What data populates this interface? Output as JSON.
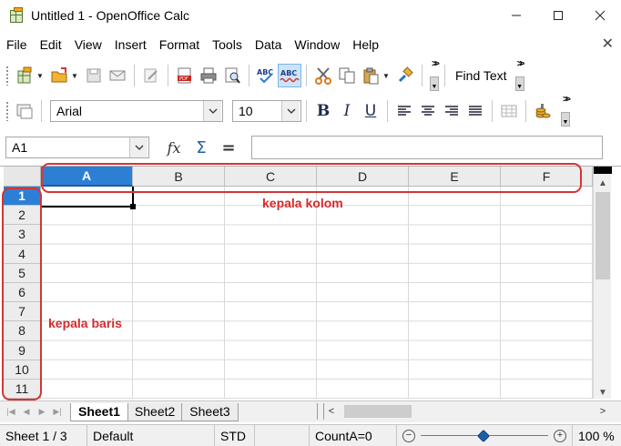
{
  "window": {
    "title": "Untitled 1 - OpenOffice Calc",
    "controls": [
      "minimize",
      "maximize",
      "close"
    ]
  },
  "menubar": {
    "items": [
      {
        "label": "File"
      },
      {
        "label": "Edit"
      },
      {
        "label": "View"
      },
      {
        "label": "Insert"
      },
      {
        "label": "Format"
      },
      {
        "label": "Tools"
      },
      {
        "label": "Data"
      },
      {
        "label": "Window"
      },
      {
        "label": "Help"
      }
    ],
    "close_glyph": "✕"
  },
  "standard_toolbar": {
    "buttons": [
      "new-document-icon",
      "open-folder-icon",
      "save-icon",
      "email-icon",
      "edit-file-icon",
      "export-pdf-icon",
      "print-icon",
      "print-preview-icon",
      "spellcheck-icon",
      "autospellcheck-icon",
      "cut-icon",
      "copy-icon",
      "paste-icon",
      "format-paintbrush-icon"
    ],
    "find_text_label": "Find Text",
    "spell_label": "ABC"
  },
  "formatting_toolbar": {
    "font_name": "Arial",
    "font_size": "10",
    "bold": "B",
    "italic": "I",
    "underline": "U"
  },
  "formula_bar": {
    "name_box": "A1",
    "function_wizard": "fx",
    "sum_symbol": "Σ",
    "equals_symbol": "=",
    "formula_value": ""
  },
  "sheet": {
    "column_headers": [
      "A",
      "B",
      "C",
      "D",
      "E",
      "F"
    ],
    "row_headers": [
      "1",
      "2",
      "3",
      "4",
      "5",
      "6",
      "7",
      "8",
      "9",
      "10",
      "11"
    ],
    "selected_cell": "A1"
  },
  "annotations": {
    "columns_label": "kepala kolom",
    "rows_label": "kepala baris",
    "color": "#d42b2b"
  },
  "tabs": {
    "sheets": [
      "Sheet1",
      "Sheet2",
      "Sheet3"
    ],
    "active_index": 0
  },
  "statusbar": {
    "sheet_position": "Sheet 1 / 3",
    "page_style": "Default",
    "selection_mode": "STD",
    "count_summary": "CountA=0",
    "zoom_level": "100 %",
    "zoom_fraction": 0.5
  },
  "colors": {
    "selection_blue": "#2d7fd6",
    "annotation_red": "#d43535"
  }
}
